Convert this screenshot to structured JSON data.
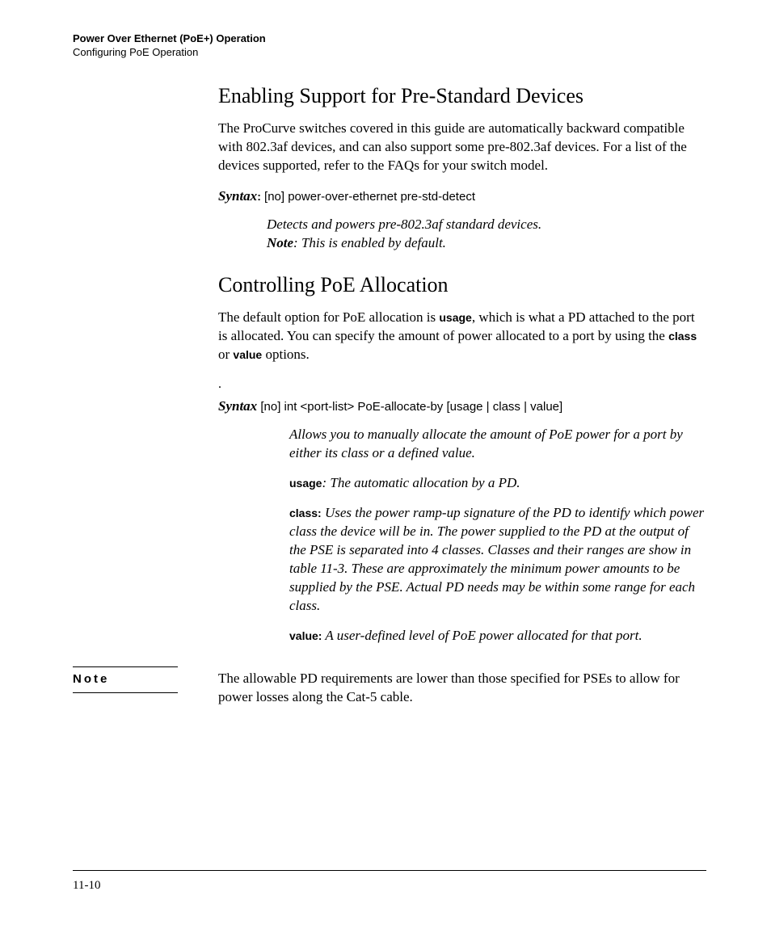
{
  "header": {
    "chapter": "Power Over Ethernet (PoE+) Operation",
    "section": "Configuring PoE Operation"
  },
  "section1": {
    "heading": "Enabling Support for Pre-Standard Devices",
    "para": "The ProCurve switches covered in this guide are automatically backward compatible with 802.3af devices, and can also support some pre-802.3af devices. For a list of the devices supported, refer to the FAQs for your switch model.",
    "syntax": {
      "label": "Syntax",
      "colon": ":",
      "cmd": " [no] power-over-ethernet pre-std-detect",
      "desc": "Detects and powers pre-802.3af standard devices.",
      "note_label": "Note",
      "note_text": ": This is enabled by default."
    }
  },
  "section2": {
    "heading": "Controlling PoE Allocation",
    "para_pre": "The default option for PoE allocation is ",
    "para_bold1": "usage",
    "para_mid": ", which is what a PD attached to the port is allocated. You can specify the amount of power allocated to a port by using the ",
    "para_bold2": "class",
    "para_or": " or ",
    "para_bold3": "value",
    "para_post": " options.",
    "dot": ".",
    "syntax": {
      "label": "Syntax",
      "cmd": "  [no] int <port-list> PoE-allocate-by [usage | class | value]",
      "desc": "Allows you to manually allocate the amount of PoE power for a port by either its class or a defined value.",
      "usage_label": "usage",
      "usage_text": ": The automatic allocation by a PD.",
      "class_label": "class:",
      "class_text": " Uses the power ramp-up signature of the PD to identify which power class the device will be in. The power supplied to the PD at the output of the PSE is separated into 4 classes. Classes and their ranges are show in table 11-3. These are approximately the minimum power amounts to be supplied by the PSE. Actual PD needs may be within some range for each class.",
      "value_label": "value:",
      "value_text": " A user-defined level of PoE power allocated for that port."
    }
  },
  "note": {
    "label": "Note",
    "text": "The allowable PD requirements are lower than those specified for PSEs to allow for power losses along the Cat-5 cable."
  },
  "footer": {
    "page": "11-10"
  }
}
